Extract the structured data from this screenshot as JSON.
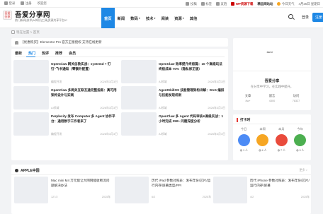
{
  "topbar": {
    "login": "登录",
    "register": "注册",
    "welcome": "欢迎您",
    "right_links": [
      "投稿",
      "标签",
      "友链",
      "WP资源下载",
      "精品网站站"
    ],
    "weather": "今日天气",
    "date": "4月26日 星期日"
  },
  "header": {
    "logo_text": "吾爱分享",
    "site_name": "吾爱分享网",
    "site_desc": "热门新闻|技术|AI知识|工具|资源共享平台☑",
    "nav": [
      {
        "label": "首页",
        "active": true,
        "dropdown": false
      },
      {
        "label": "新闻",
        "active": false,
        "dropdown": false
      },
      {
        "label": "数码",
        "active": false,
        "dropdown": true
      },
      {
        "label": "技术",
        "active": false,
        "dropdown": true
      },
      {
        "label": "阅读",
        "active": false,
        "dropdown": false
      },
      {
        "label": "资源",
        "active": false,
        "dropdown": true
      },
      {
        "label": "其他",
        "active": false,
        "dropdown": false
      }
    ],
    "login_label": "登录",
    "register_label": "注册"
  },
  "breadcrumb": {
    "text": "现在位置 > 首页"
  },
  "notice": {
    "text": "【优惠购买】Elementor Pro 官方正版授权 支持在线更新"
  },
  "main": {
    "tabs": [
      {
        "label": "最新",
        "active": false
      },
      {
        "label": "热门",
        "active": true
      },
      {
        "label": "热评",
        "active": false
      },
      {
        "label": "推荐",
        "active": false
      },
      {
        "label": "会员",
        "active": false
      }
    ],
    "posts": [
      {
        "title": "OpenClaw 网关自救实战：systemd + 钉钉“飞书通知（零额外配置）",
        "category": "编程开发",
        "date": "2026年3月3日"
      },
      {
        "title": "OpenClaw 效率提升终极篇：10 个高级玩法终极成本 70%（隐私修正版）",
        "category": "AI领域",
        "date": "2026年3月3日"
      },
      {
        "title": "OpenClaw 多网关互联互通完整指南：真可用架构设计与实践",
        "category": "AI领域",
        "date": "2026年3月3日"
      },
      {
        "title": "AgentSkillOS 技能管理架构详解：DAG 编排与技能发现机制",
        "category": "AI领域",
        "date": "2026年3月3日"
      },
      {
        "title": "Perplexity 发布 Computer 多 Agent 协作平台：通用数字工作者来了",
        "category": "编程开发",
        "date": "2026年3月3日"
      },
      {
        "title": "OpenClaw 多 Agent 代码审核&高级实战：1 小时完成 350+ 问题深度分析",
        "category": "AI领域",
        "date": "2026年3月3日"
      }
    ]
  },
  "profile": {
    "avatar_text": "ваme",
    "name": "吾爱分享",
    "slogan": "在分享中学习，在实践中提升。",
    "stats": [
      {
        "label": "文章",
        "value": "8w+"
      },
      {
        "label": "留言",
        "value": "4300"
      },
      {
        "label": "访问",
        "value": "78327"
      }
    ]
  },
  "checkin": {
    "title": "打卡时",
    "items": [
      {
        "label": "今日",
        "count": "1 人",
        "color": "#4c8bf5"
      },
      {
        "label": "本周",
        "count": "4 人",
        "color": "#f6a623"
      },
      {
        "label": "本月",
        "count": "7 人",
        "color": "#e94b3c"
      },
      {
        "label": "今年",
        "count": "9 人",
        "color": "#4caf50"
      }
    ]
  },
  "apple": {
    "title": "APPLE中国",
    "more": "更多 >",
    "items": [
      {
        "title": "Mac mini M4 万元能让大网网能收断流问题解决办法",
        "meta_left": "127/2",
        "meta_right": "2025年"
      },
      {
        "title": "历代 iPad 参数对照表：发布年份/芯片/运行内存/屏幕类型/PPI",
        "meta_left": "6/2",
        "meta_right": "2025年"
      },
      {
        "title": "历代 iPhone 参数对照表：发布年份/芯片/运行内存/屏幕",
        "meta_left": "4/2",
        "meta_right": "2025年"
      }
    ]
  }
}
